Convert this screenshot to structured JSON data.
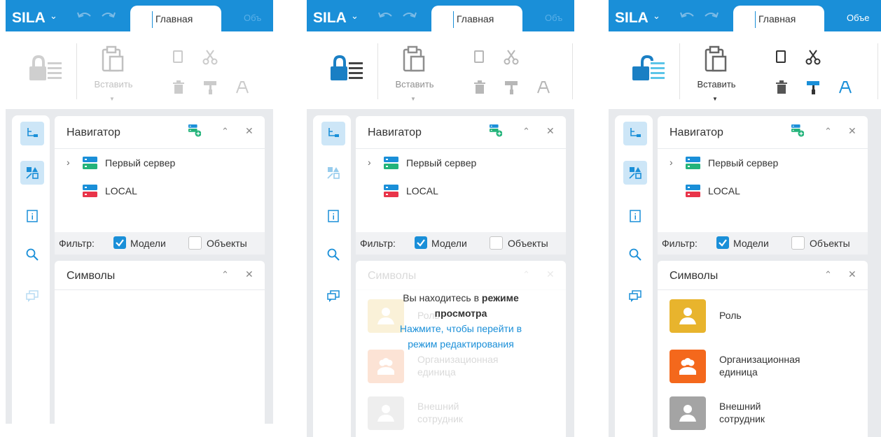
{
  "app": {
    "logo": "SILA",
    "tabs": [
      "Главная",
      "Объ",
      "Объе"
    ],
    "paste_label": "Вставить"
  },
  "navigator": {
    "title": "Навигатор",
    "items": [
      {
        "label": "Первый сервер",
        "expandable": true
      },
      {
        "label": "LOCAL",
        "expandable": false
      }
    ],
    "filter": {
      "label": "Фильтр:",
      "options": [
        {
          "label": "Модели",
          "checked": true
        },
        {
          "label": "Объекты",
          "checked": false
        }
      ]
    }
  },
  "symbols": {
    "title": "Символы",
    "items": [
      {
        "line1": "Роль",
        "line2": "",
        "color": "#e8b42d",
        "icon": "role-icon"
      },
      {
        "line1": "Организационная",
        "line2": "единица",
        "color": "#f4681c",
        "icon": "org-unit-icon"
      },
      {
        "line1": "Внешний",
        "line2": "сотрудник",
        "color": "#a4a4a4",
        "icon": "external-employee-icon"
      }
    ]
  },
  "view_mode": {
    "line1": "Вы находитесь в ",
    "line1_bold": "режиме",
    "line2_bold": "просмотра",
    "line3": "Нажмите, чтобы перейти в",
    "line4": "режим редактирования"
  },
  "colors": {
    "brand_blue": "#1a8fd8",
    "server_green": "#23b37a",
    "server_red": "#e8344a",
    "lock_teal": "#5bc5e8"
  }
}
